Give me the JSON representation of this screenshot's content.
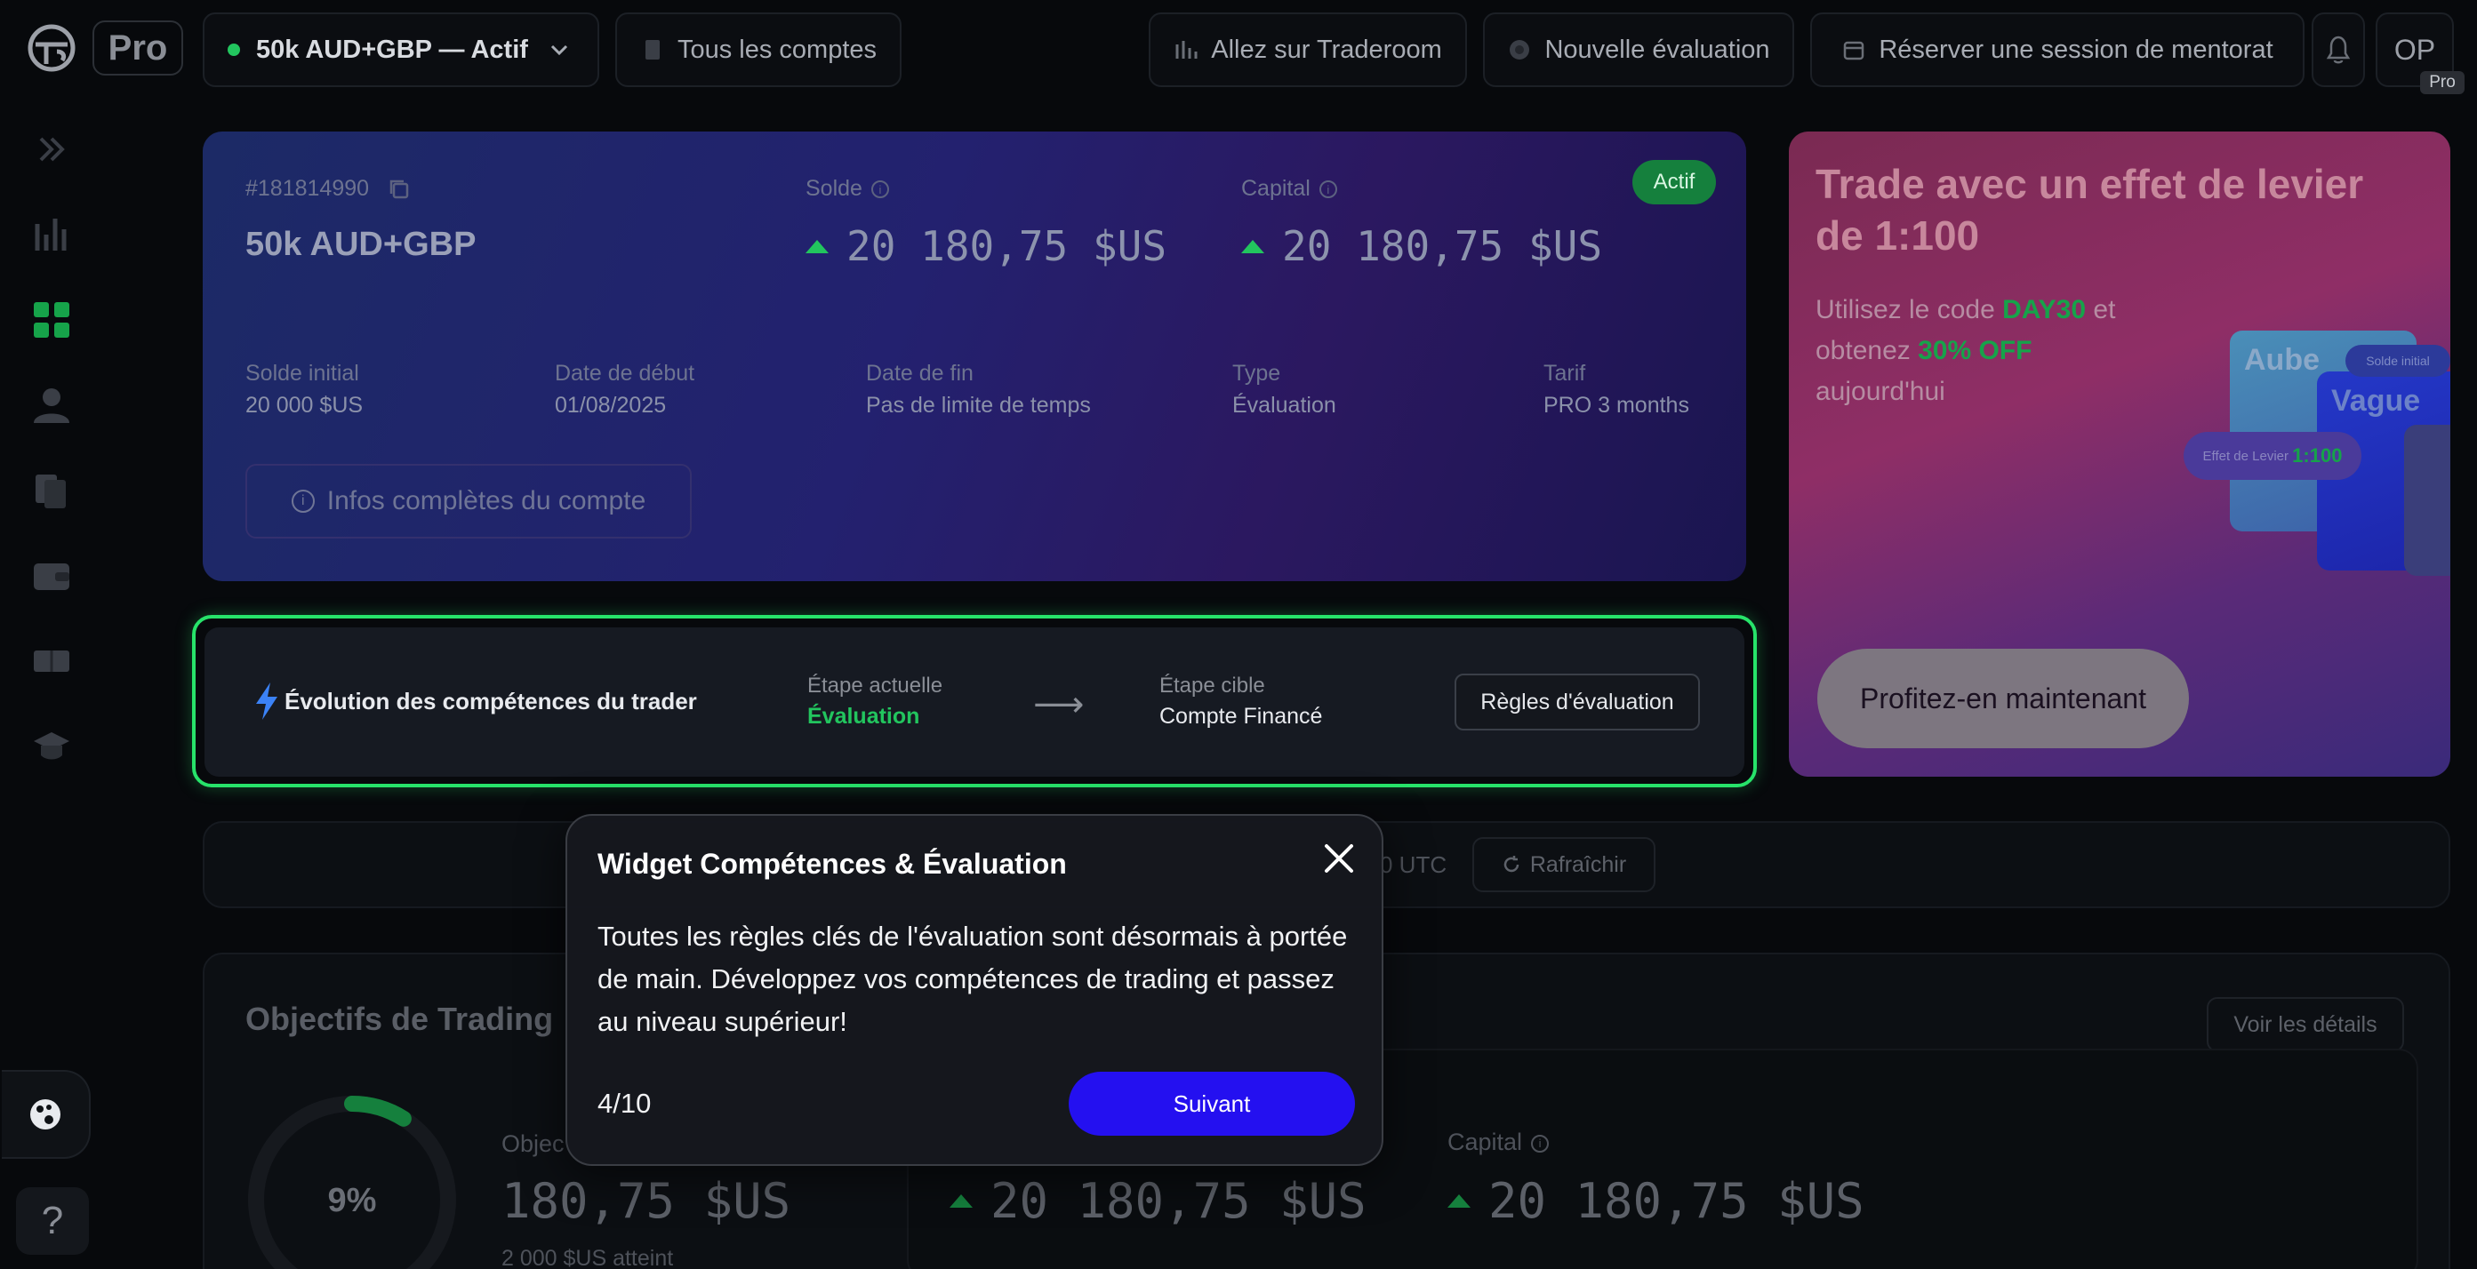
{
  "app": {
    "plan_badge": "Pro"
  },
  "topbar": {
    "account_selector": "50k AUD+GBP — Actif",
    "all_accounts": "Tous les comptes",
    "traderoom": "Allez sur Traderoom",
    "new_evaluation": "Nouvelle évaluation",
    "mentoring": "Réserver une session de mentorat",
    "avatar_initials": "OP",
    "avatar_badge": "Pro"
  },
  "account": {
    "id": "#181814990",
    "name": "50k AUD+GBP",
    "status": "Actif",
    "balance_label": "Solde",
    "balance": "20 180,75 $US",
    "equity_label": "Capital",
    "equity": "20 180,75 $US",
    "fields": [
      {
        "label": "Solde initial",
        "value": "20 000 $US"
      },
      {
        "label": "Date de début",
        "value": "01/08/2025"
      },
      {
        "label": "Date de fin",
        "value": "Pas de limite de temps"
      },
      {
        "label": "Type",
        "value": "Évaluation"
      },
      {
        "label": "Tarif",
        "value": "PRO 3 months"
      }
    ],
    "full_info_button": "Infos complètes du compte"
  },
  "promo": {
    "title": "Trade avec un effet de levier de 1:100",
    "text_prefix": "Utilisez le code ",
    "code": "DAY30",
    "text_mid": " et obtenez ",
    "discount": "30% OFF",
    "text_suffix": " aujourd'hui",
    "cta": "Profitez-en maintenant",
    "card_labels": {
      "aube": "Aube",
      "vague": "Vague",
      "initial_balance": "Solde initial",
      "leverage_label": "Effet de Levier",
      "leverage_value": "1:100"
    }
  },
  "evolution": {
    "title": "Évolution des compétences du trader",
    "current_label": "Étape actuelle",
    "current_value": "Évaluation",
    "target_label": "Étape cible",
    "target_value": "Compte Financé",
    "rules_button": "Règles d'évaluation"
  },
  "sync_bar": {
    "utc_text": "0 UTC",
    "refresh": "Rafraîchir"
  },
  "objectives": {
    "title": "Objectifs de Trading",
    "details_button": "Voir les détails",
    "progress_percent": 9,
    "progress_label": "9%",
    "objective_label": "Objec",
    "objective_value": "180,75 $US",
    "objective_sub": "2 000 $US atteint",
    "balance_value": "20 180,75 $US",
    "capital_label": "Capital",
    "capital_value": "20 180,75 $US"
  },
  "modal": {
    "title": "Widget Compétences & Évaluation",
    "body": "Toutes les règles clés de l'évaluation sont désormais à portée de main. Développez vos compétences de trading et passez au niveau supérieur!",
    "step": "4/10",
    "next": "Suivant"
  },
  "sidebar": {
    "icons": [
      "expand-icon",
      "chart-icon",
      "dashboard-icon",
      "user-icon",
      "documents-icon",
      "wallet-icon",
      "ticket-icon",
      "graduation-icon"
    ],
    "help": "?"
  },
  "colors": {
    "accent_green": "#22c55e",
    "highlight_border": "#27e36a",
    "primary_button": "#2410f0"
  }
}
